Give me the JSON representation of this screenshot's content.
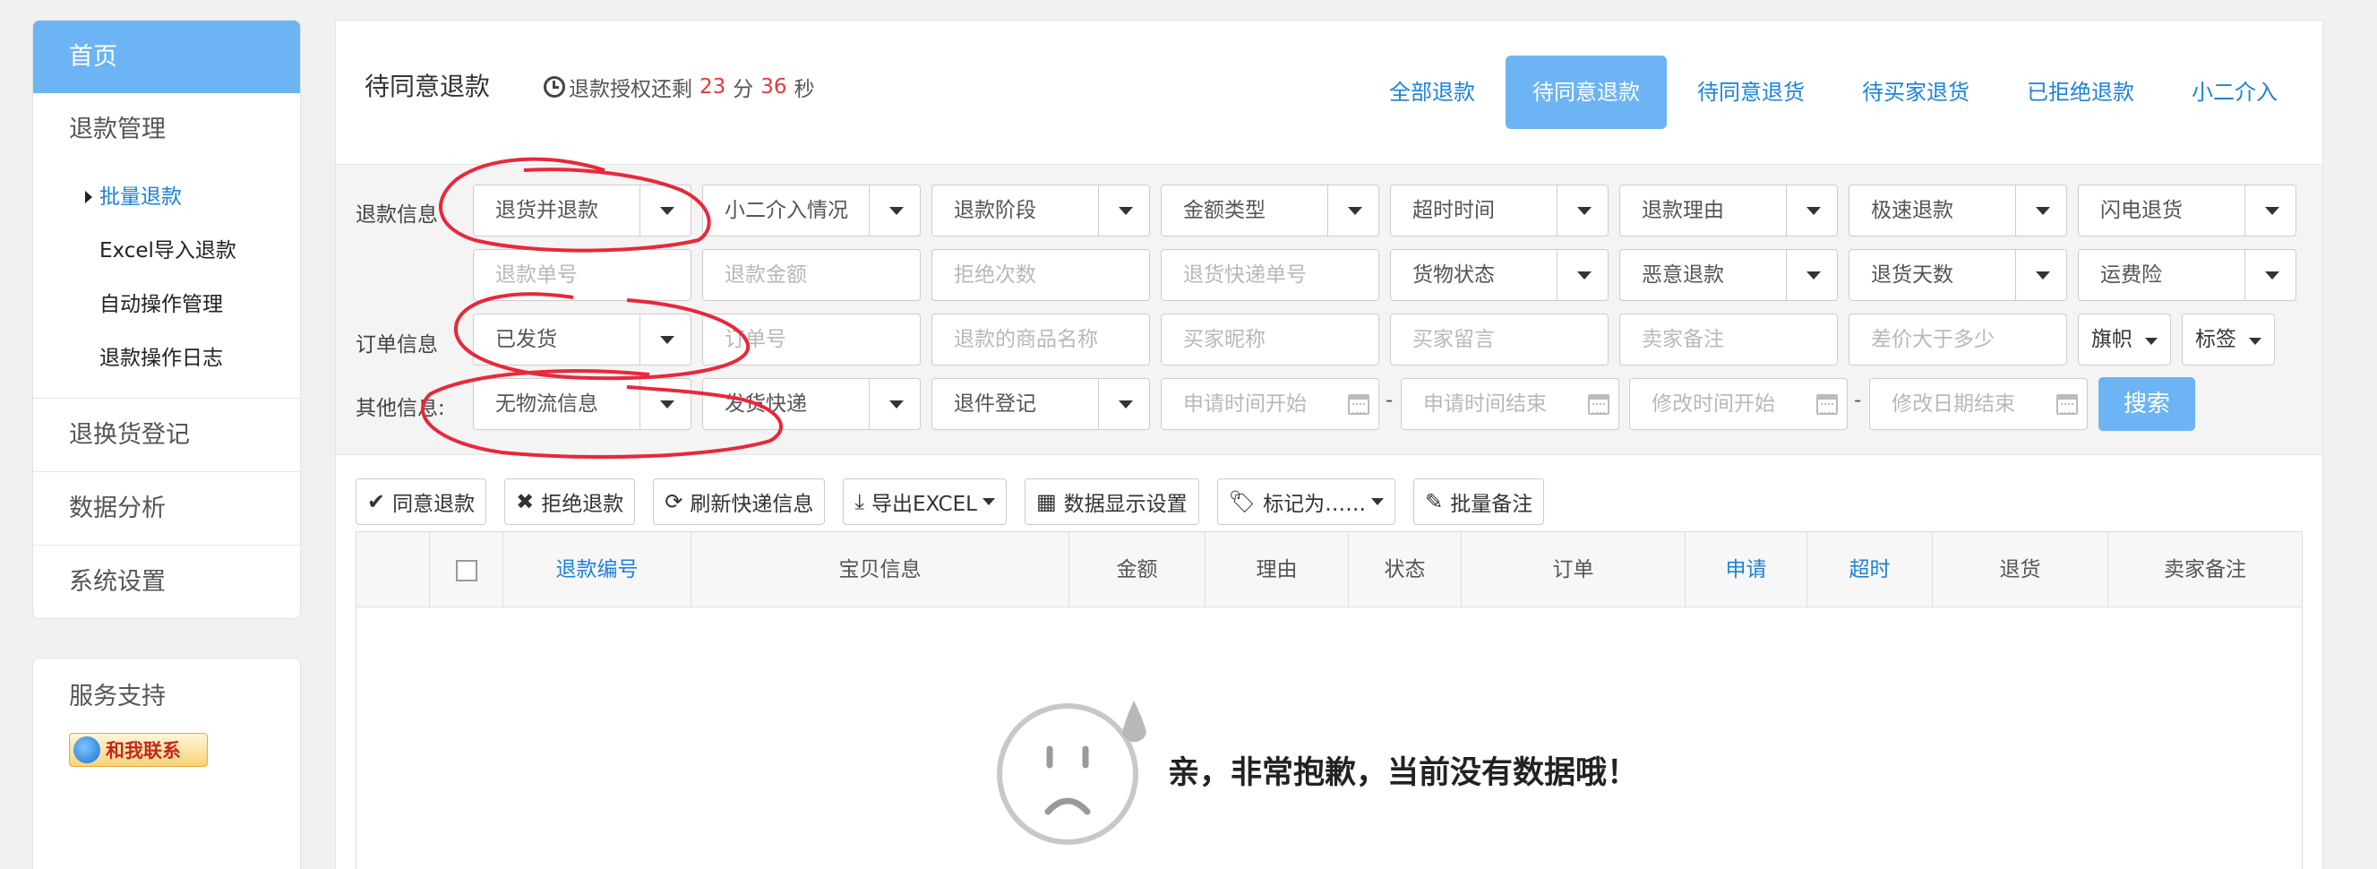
{
  "sidebar": {
    "home": "首页",
    "refund_mgmt": "退款管理",
    "sub_items": [
      "批量退款",
      "Excel导入退款",
      "自动操作管理",
      "退款操作日志"
    ],
    "groups": [
      "退换货登记",
      "数据分析",
      "系统设置"
    ]
  },
  "support": {
    "title": "服务支持",
    "contact_label": "和我联系"
  },
  "header": {
    "title": "待同意退款",
    "countdown_prefix": "退款授权还剩",
    "minutes": "23",
    "minutes_unit": "分",
    "seconds": "36",
    "seconds_unit": "秒",
    "tabs": [
      "全部退款",
      "待同意退款",
      "待同意退货",
      "待买家退货",
      "已拒绝退款",
      "小二介入"
    ]
  },
  "filters": {
    "labels": {
      "refund_info": "退款信息",
      "order_info": "订单信息",
      "other_info": "其他信息:"
    },
    "row1": [
      "退货并退款",
      "小二介入情况",
      "退款阶段",
      "金额类型",
      "超时时间",
      "退款理由",
      "极速退款",
      "闪电退货"
    ],
    "row2": [
      {
        "text": "退款单号",
        "type": "input"
      },
      {
        "text": "退款金额",
        "type": "input"
      },
      {
        "text": "拒绝次数",
        "type": "input"
      },
      {
        "text": "退货快递单号",
        "type": "input"
      },
      {
        "text": "货物状态",
        "type": "select"
      },
      {
        "text": "恶意退款",
        "type": "select"
      },
      {
        "text": "退货天数",
        "type": "select"
      },
      {
        "text": "运费险",
        "type": "select"
      }
    ],
    "row3": {
      "status": "已发货",
      "inputs": [
        "订单号",
        "退款的商品名称",
        "买家昵称",
        "买家留言",
        "卖家备注",
        "差价大于多少"
      ],
      "flag": "旗帜",
      "tag": "标签"
    },
    "row4": {
      "selects": [
        "无物流信息",
        "发货快递",
        "退件登记"
      ],
      "dates": [
        "申请时间开始",
        "申请时间结束",
        "修改时间开始",
        "修改日期结束"
      ],
      "dash": "-",
      "search": "搜索"
    }
  },
  "toolbar": {
    "buttons": [
      "同意退款",
      "拒绝退款",
      "刷新快递信息",
      "导出EXCEL",
      "数据显示设置",
      "标记为……",
      "批量备注"
    ]
  },
  "table": {
    "columns": [
      "退款编号",
      "宝贝信息",
      "金额",
      "理由",
      "状态",
      "订单",
      "申请",
      "超时",
      "退货",
      "卖家备注"
    ],
    "empty_text": "亲，非常抱歉，当前没有数据哦！"
  },
  "colors": {
    "accent": "#6cb4f3",
    "link": "#1d82d8",
    "countdown_red": "#e23b3b",
    "annotation": "#e8283a"
  }
}
